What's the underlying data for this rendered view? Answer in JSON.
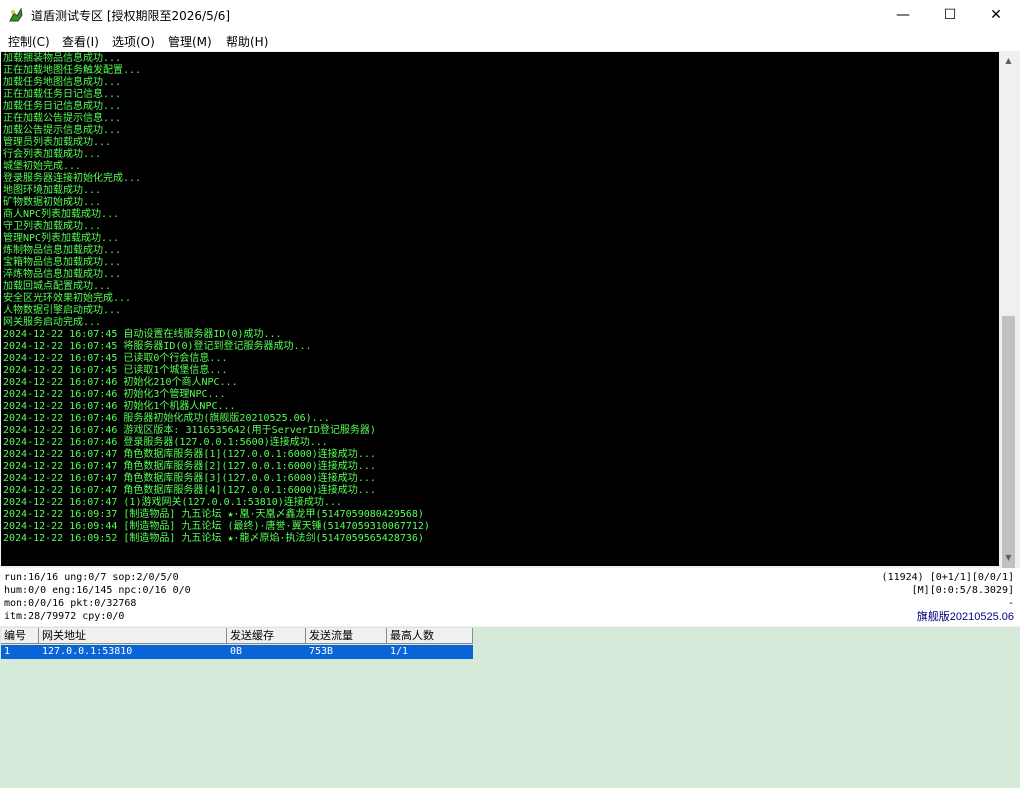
{
  "window": {
    "title": "道盾测试专区 [授权期限至2026/5/6]",
    "minimize": "—",
    "maximize": "☐",
    "close": "✕",
    "accent": "#000000"
  },
  "menu": [
    "控制(C)",
    "查看(I)",
    "选项(O)",
    "管理(M)",
    "帮助(H)"
  ],
  "console_lines": [
    "加载捆装物品信息成功...",
    "正在加载地图任务触发配置...",
    "加载任务地图信息成功...",
    "正在加载任务日记信息...",
    "加载任务日记信息成功...",
    "正在加载公告提示信息...",
    "加载公告提示信息成功...",
    "管理员列表加载成功...",
    "行会列表加载成功...",
    "城堡初始完成...",
    "登录服务器连接初始化完成...",
    "地图环境加载成功...",
    "矿物数据初始成功...",
    "商人NPC列表加载成功...",
    "守卫列表加载成功...",
    "管理NPC列表加载成功...",
    "炼制物品信息加载成功...",
    "宝箱物品信息加载成功...",
    "淬炼物品信息加载成功...",
    "加载回城点配置成功...",
    "安全区光环效果初始完成...",
    "人物数据引擎启动成功...",
    "网关服务启动完成...",
    "2024-12-22 16:07:45 自动设置在线服务器ID(0)成功...",
    "2024-12-22 16:07:45 将服务器ID(0)登记到登记服务器成功...",
    "2024-12-22 16:07:45 已读取0个行会信息...",
    "2024-12-22 16:07:45 已读取1个城堡信息...",
    "2024-12-22 16:07:46 初始化210个商人NPC...",
    "2024-12-22 16:07:46 初始化3个管理NPC...",
    "2024-12-22 16:07:46 初始化1个机器人NPC...",
    "2024-12-22 16:07:46 服务器初始化成功(旗舰版20210525.06)...",
    "2024-12-22 16:07:46 游戏区版本: 3116535642(用于ServerID登记服务器)",
    "2024-12-22 16:07:46 登录服务器(127.0.0.1:5600)连接成功...",
    "2024-12-22 16:07:47 角色数据库服务器[1](127.0.0.1:6000)连接成功...",
    "2024-12-22 16:07:47 角色数据库服务器[2](127.0.0.1:6000)连接成功...",
    "2024-12-22 16:07:47 角色数据库服务器[3](127.0.0.1:6000)连接成功...",
    "2024-12-22 16:07:47 角色数据库服务器[4](127.0.0.1:6000)连接成功...",
    "2024-12-22 16:07:47 (1)游戏网关(127.0.0.1:53810)连接成功...",
    "2024-12-22 16:09:37 [制造物品] 九五论坛 ★·凰·天凰〆鑫龙甲(5147059080429568)",
    "2024-12-22 16:09:44 [制造物品] 九五论坛 (最终)·唐誉·翼天锤(5147059310067712)",
    "2024-12-22 16:09:52 [制造物品] 九五论坛 ★·龍〆原焰·执法剑(5147059565428736)"
  ],
  "console_color": "#55ff55",
  "status": {
    "line1_left": "run:16/16 ung:0/7 sop:2/0/5/0",
    "line2_left": "hum:0/0 eng:16/145 npc:0/16 0/0",
    "line3_left": "mon:0/0/16 pkt:0/32768",
    "line4_left": "itm:28/79972 cpy:0/0",
    "line1_right": "(11924) [0+1/1][0/0/1]",
    "line2_right": "[M][0:0:5/8.3029]",
    "line3_right": "-",
    "line4_right": "旗舰版20210525.06"
  },
  "gateway_table": {
    "columns": [
      "编号",
      "网关地址",
      "发送缓存",
      "发送流量",
      "最高人数"
    ],
    "rows": [
      [
        "1",
        "127.0.0.1:53810",
        "0B",
        "753B",
        "1/1"
      ]
    ],
    "selected_color": "#0a64d8"
  }
}
